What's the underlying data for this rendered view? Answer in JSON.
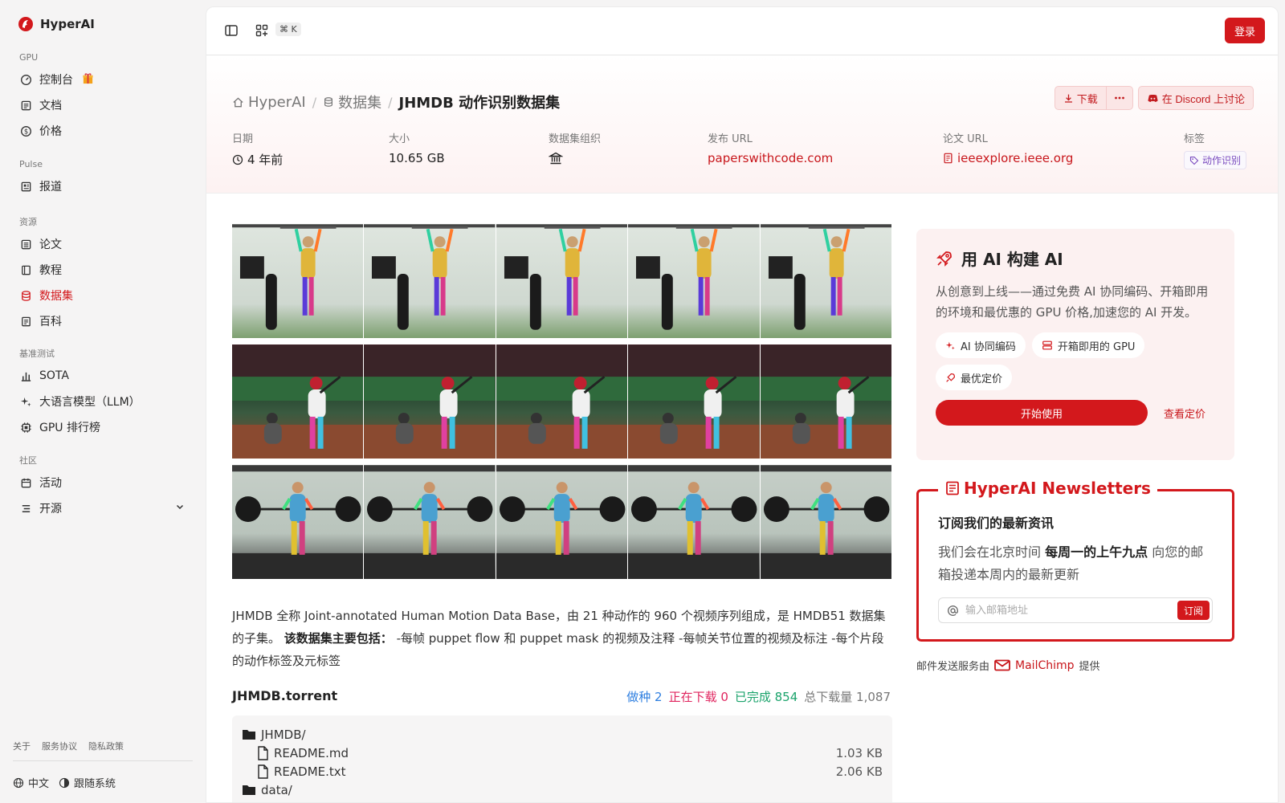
{
  "brand": {
    "name": "HyperAI"
  },
  "sidebar": {
    "sections": [
      {
        "title": "GPU",
        "items": [
          {
            "label": "控制台",
            "icon": "gauge-icon",
            "badge": "gift-icon"
          },
          {
            "label": "文档",
            "icon": "doc-icon"
          },
          {
            "label": "价格",
            "icon": "dollar-icon"
          }
        ]
      },
      {
        "title": "Pulse",
        "items": [
          {
            "label": "报道",
            "icon": "news-icon"
          }
        ]
      },
      {
        "title": "资源",
        "items": [
          {
            "label": "论文",
            "icon": "paper-icon"
          },
          {
            "label": "教程",
            "icon": "book-icon"
          },
          {
            "label": "数据集",
            "icon": "database-icon",
            "active": true
          },
          {
            "label": "百科",
            "icon": "wiki-icon"
          }
        ]
      },
      {
        "title": "基准测试",
        "items": [
          {
            "label": "SOTA",
            "icon": "bar-chart-icon"
          },
          {
            "label": "大语言模型（LLM）",
            "icon": "sparkle-icon"
          },
          {
            "label": "GPU 排行榜",
            "icon": "chip-icon"
          }
        ]
      },
      {
        "title": "社区",
        "items": [
          {
            "label": "活动",
            "icon": "calendar-icon"
          },
          {
            "label": "开源",
            "icon": "list-icon"
          }
        ]
      }
    ],
    "footer_links": [
      "关于",
      "服务协议",
      "隐私政策"
    ],
    "language": "中文",
    "theme": "跟随系统"
  },
  "topbar": {
    "shortcut": "⌘ K",
    "login": "登录"
  },
  "breadcrumb": {
    "home": "HyperAI",
    "section": "数据集",
    "current": "JHMDB 动作识别数据集"
  },
  "actions": {
    "download": "下载",
    "discord": "在 Discord 上讨论"
  },
  "meta": {
    "date_label": "日期",
    "date_value": "4 年前",
    "size_label": "大小",
    "size_value": "10.65 GB",
    "org_label": "数据集组织",
    "publish_label": "发布 URL",
    "publish_value": "paperswithcode.com",
    "paper_label": "论文 URL",
    "paper_value": "ieeexplore.ieee.org",
    "tags_label": "标签",
    "tag_value": "动作识别"
  },
  "description": {
    "text1": "JHMDB 全称 Joint-annotated Human Motion Data Base，由 21 种动作的 960 个视频序列组成，是 HMDB51 数据集的子集。",
    "bold": "该数据集主要包括：",
    "text2": "-每帧 puppet flow 和 puppet mask 的视频及注释 -每帧关节位置的视频及标注 -每个片段的动作标签及元标签"
  },
  "torrent": {
    "title": "JHMDB.torrent",
    "seeding": "做种 2",
    "downloading": "正在下载 0",
    "completed": "已完成 854",
    "total": "总下载量 1,087",
    "files": [
      {
        "name": "JHMDB/",
        "type": "folder",
        "size": "",
        "indent": 0
      },
      {
        "name": "README.md",
        "type": "file",
        "size": "1.03 KB",
        "indent": 1
      },
      {
        "name": "README.txt",
        "type": "file",
        "size": "2.06 KB",
        "indent": 1
      },
      {
        "name": "data/",
        "type": "folder",
        "size": "",
        "indent": 0
      }
    ]
  },
  "promo": {
    "title": "用 AI 构建 AI",
    "desc": "从创意到上线——通过免费 AI 协同编码、开箱即用的环境和最优惠的 GPU 价格,加速您的 AI 开发。",
    "chips": [
      "AI 协同编码",
      "开箱即用的 GPU",
      "最优定价"
    ],
    "start": "开始使用",
    "pricing": "查看定价"
  },
  "newsletter": {
    "legend": "HyperAI Newsletters",
    "title": "订阅我们的最新资讯",
    "desc_pre": "我们会在北京时间",
    "desc_bold": "每周一的上午九点",
    "desc_post": "向您的邮箱投递本周内的最新更新",
    "placeholder": "输入邮箱地址",
    "subscribe": "订阅",
    "footer_pre": "邮件发送服务由",
    "footer_brand": "MailChimp",
    "footer_post": "提供"
  },
  "colors": {
    "accent": "#d3181c",
    "seeding": "#2f7fe0",
    "downloading": "#e0245e",
    "completed": "#1aa36b",
    "total": "#777777"
  }
}
